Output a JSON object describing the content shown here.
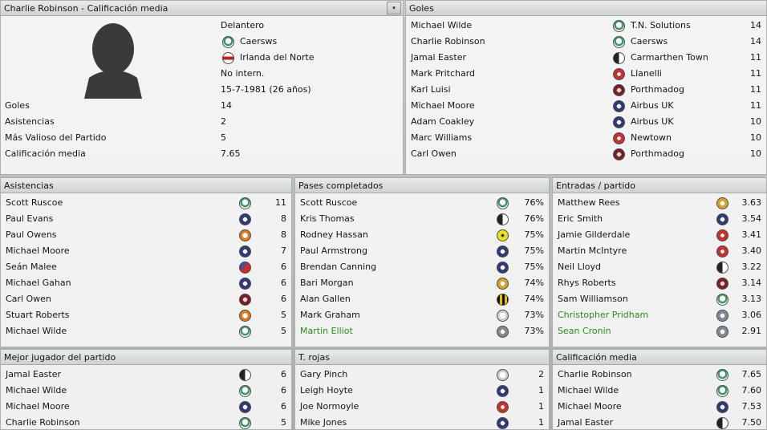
{
  "profile": {
    "title": "Charlie Robinson - Calificación media",
    "dropdown_glyph": "▾",
    "position": "Delantero",
    "club": "Caersws",
    "nation": "Irlanda del Norte",
    "intl": "No intern.",
    "dob": "15-7-1981 (26 años)",
    "stats": [
      {
        "label": "Goles",
        "value": "14"
      },
      {
        "label": "Asistencias",
        "value": "2"
      },
      {
        "label": "Más Valioso del Partido",
        "value": "5"
      },
      {
        "label": "Calificación media",
        "value": "7.65"
      }
    ]
  },
  "goles": {
    "title": "Goles",
    "rows": [
      {
        "name": "Michael Wilde",
        "club": "T.N. Solutions",
        "value": "14",
        "badge": "b-green"
      },
      {
        "name": "Charlie Robinson",
        "club": "Caersws",
        "value": "14",
        "badge": "b-green"
      },
      {
        "name": "Jamal Easter",
        "club": "Carmarthen Town",
        "value": "11",
        "badge": "b-bw"
      },
      {
        "name": "Mark Pritchard",
        "club": "Llanelli",
        "value": "11",
        "badge": "b-red2"
      },
      {
        "name": "Karl Luisi",
        "club": "Porthmadog",
        "value": "11",
        "badge": "b-maroon"
      },
      {
        "name": "Michael Moore",
        "club": "Airbus UK",
        "value": "11",
        "badge": "b-navy"
      },
      {
        "name": "Adam Coakley",
        "club": "Airbus UK",
        "value": "10",
        "badge": "b-navy"
      },
      {
        "name": "Marc Williams",
        "club": "Newtown",
        "value": "10",
        "badge": "b-red2"
      },
      {
        "name": "Carl Owen",
        "club": "Porthmadog",
        "value": "10",
        "badge": "b-maroon"
      }
    ]
  },
  "asistencias": {
    "title": "Asistencias",
    "rows": [
      {
        "name": "Scott Ruscoe",
        "value": "11",
        "badge": "b-green"
      },
      {
        "name": "Paul Evans",
        "value": "8",
        "badge": "b-navy"
      },
      {
        "name": "Paul Owens",
        "value": "8",
        "badge": "b-orange"
      },
      {
        "name": "Michael Moore",
        "value": "7",
        "badge": "b-navy"
      },
      {
        "name": "Seán Malee",
        "value": "6",
        "badge": "b-red"
      },
      {
        "name": "Michael Gahan",
        "value": "6",
        "badge": "b-navy"
      },
      {
        "name": "Carl Owen",
        "value": "6",
        "badge": "b-maroon"
      },
      {
        "name": "Stuart Roberts",
        "value": "5",
        "badge": "b-orange"
      },
      {
        "name": "Michael Wilde",
        "value": "5",
        "badge": "b-green"
      }
    ]
  },
  "pases": {
    "title": "Pases completados",
    "rows": [
      {
        "name": "Scott Ruscoe",
        "value": "76%",
        "badge": "b-green"
      },
      {
        "name": "Kris Thomas",
        "value": "76%",
        "badge": "b-bw"
      },
      {
        "name": "Rodney Hassan",
        "value": "75%",
        "badge": "b-yellow"
      },
      {
        "name": "Paul Armstrong",
        "value": "75%",
        "badge": "b-navy"
      },
      {
        "name": "Brendan Canning",
        "value": "75%",
        "badge": "b-navy"
      },
      {
        "name": "Bari Morgan",
        "value": "74%",
        "badge": "b-gold"
      },
      {
        "name": "Alan Gallen",
        "value": "74%",
        "badge": "b-stripe"
      },
      {
        "name": "Mark Graham",
        "value": "73%",
        "badge": "b-light"
      },
      {
        "name": "Martin Elliot",
        "value": "73%",
        "badge": "b-grey",
        "green": true
      }
    ]
  },
  "entradas": {
    "title": "Entradas / partido",
    "rows": [
      {
        "name": "Matthew Rees",
        "value": "3.63",
        "badge": "b-gold"
      },
      {
        "name": "Eric Smith",
        "value": "3.54",
        "badge": "b-navy"
      },
      {
        "name": "Jamie Gilderdale",
        "value": "3.41",
        "badge": "b-red2"
      },
      {
        "name": "Martin McIntyre",
        "value": "3.40",
        "badge": "b-red2"
      },
      {
        "name": "Neil Lloyd",
        "value": "3.22",
        "badge": "b-bw"
      },
      {
        "name": "Rhys Roberts",
        "value": "3.14",
        "badge": "b-maroon"
      },
      {
        "name": "Sam Williamson",
        "value": "3.13",
        "badge": "b-green"
      },
      {
        "name": "Christopher Pridham",
        "value": "3.06",
        "badge": "b-grey",
        "green": true
      },
      {
        "name": "Sean Cronin",
        "value": "2.91",
        "badge": "b-grey",
        "green": true
      }
    ]
  },
  "mejor": {
    "title": "Mejor jugador del partido",
    "rows": [
      {
        "name": "Jamal Easter",
        "value": "6",
        "badge": "b-bw"
      },
      {
        "name": "Michael Wilde",
        "value": "6",
        "badge": "b-green"
      },
      {
        "name": "Michael Moore",
        "value": "6",
        "badge": "b-navy"
      },
      {
        "name": "Charlie Robinson",
        "value": "5",
        "badge": "b-green"
      }
    ]
  },
  "rojas": {
    "title": "T. rojas",
    "rows": [
      {
        "name": "Gary Pinch",
        "value": "2",
        "badge": "b-light"
      },
      {
        "name": "Leigh Hoyte",
        "value": "1",
        "badge": "b-navy"
      },
      {
        "name": "Joe Normoyle",
        "value": "1",
        "badge": "b-red2"
      },
      {
        "name": "Mike Jones",
        "value": "1",
        "badge": "b-navy"
      }
    ]
  },
  "calificacion": {
    "title": "Calificación media",
    "rows": [
      {
        "name": "Charlie Robinson",
        "value": "7.65",
        "badge": "b-green"
      },
      {
        "name": "Michael Wilde",
        "value": "7.60",
        "badge": "b-green"
      },
      {
        "name": "Michael Moore",
        "value": "7.53",
        "badge": "b-navy"
      },
      {
        "name": "Jamal Easter",
        "value": "7.50",
        "badge": "b-bw"
      }
    ]
  }
}
